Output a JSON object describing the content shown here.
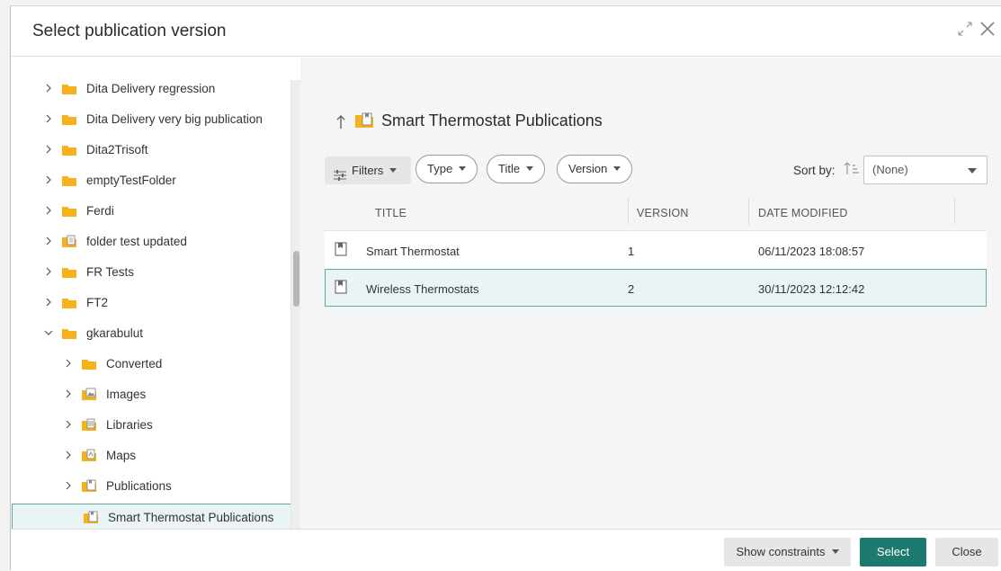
{
  "dialog": {
    "title": "Select publication version",
    "expand_icon": "expand-diagonal-icon",
    "close_icon": "close-icon"
  },
  "tree": {
    "items": [
      {
        "label": "Dita Delivery regression",
        "level": 0,
        "expanded": false,
        "icon": "folder-icon"
      },
      {
        "label": "Dita Delivery very big publication",
        "level": 0,
        "expanded": false,
        "icon": "folder-icon"
      },
      {
        "label": "Dita2Trisoft",
        "level": 0,
        "expanded": false,
        "icon": "folder-icon"
      },
      {
        "label": "emptyTestFolder",
        "level": 0,
        "expanded": false,
        "icon": "folder-icon"
      },
      {
        "label": "Ferdi",
        "level": 0,
        "expanded": false,
        "icon": "folder-icon"
      },
      {
        "label": "folder test updated",
        "level": 0,
        "expanded": false,
        "icon": "document-folder-icon"
      },
      {
        "label": "FR Tests",
        "level": 0,
        "expanded": false,
        "icon": "folder-icon"
      },
      {
        "label": "FT2",
        "level": 0,
        "expanded": false,
        "icon": "folder-icon"
      },
      {
        "label": "gkarabulut",
        "level": 0,
        "expanded": true,
        "icon": "folder-icon"
      },
      {
        "label": "Converted",
        "level": 1,
        "expanded": false,
        "icon": "folder-icon"
      },
      {
        "label": "Images",
        "level": 1,
        "expanded": false,
        "icon": "image-folder-icon"
      },
      {
        "label": "Libraries",
        "level": 1,
        "expanded": false,
        "icon": "library-folder-icon"
      },
      {
        "label": "Maps",
        "level": 1,
        "expanded": false,
        "icon": "map-folder-icon"
      },
      {
        "label": "Publications",
        "level": 1,
        "expanded": false,
        "icon": "publication-folder-icon"
      },
      {
        "label": "Smart Thermostat Publications",
        "level": 2,
        "expanded": null,
        "icon": "publication-folder-icon",
        "selected": true
      }
    ]
  },
  "content": {
    "breadcrumb_title": "Smart Thermostat Publications",
    "filters_label": "Filters",
    "filter_pills": [
      "Type",
      "Title",
      "Version"
    ],
    "sort_by_label": "Sort by:",
    "sort_value": "(None)",
    "columns": [
      "TITLE",
      "VERSION",
      "DATE MODIFIED"
    ],
    "rows": [
      {
        "title": "Smart Thermostat",
        "version": "1",
        "date": "06/11/2023 18:08:57",
        "selected": false
      },
      {
        "title": "Wireless Thermostats",
        "version": "2",
        "date": "30/11/2023 12:12:42",
        "selected": true
      }
    ]
  },
  "footer": {
    "show_constraints": "Show constraints",
    "select": "Select",
    "close": "Close"
  },
  "colors": {
    "accent": "#1e7a6f",
    "selection_bg": "#eaf4f4",
    "selection_border": "#5fa8a8",
    "folder": "#f5b21a"
  }
}
